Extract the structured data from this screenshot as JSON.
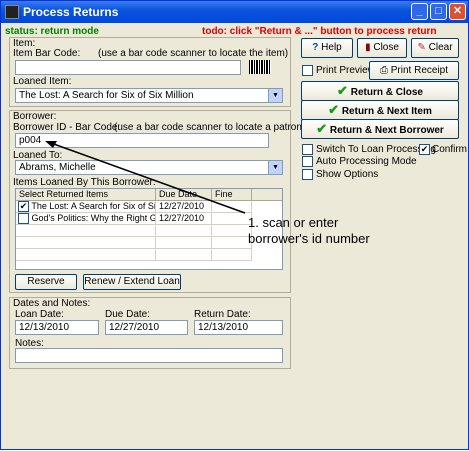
{
  "window": {
    "title": "Process Returns"
  },
  "status": {
    "mode": "status: return mode",
    "todo": "todo: click \"Return & ...\" button to process return"
  },
  "item": {
    "group_label": "Item:",
    "barcode_label": "Item Bar Code:",
    "barcode_hint": "(use a bar code scanner to locate the item)",
    "barcode_value": "",
    "loaned_label": "Loaned Item:",
    "loaned_value": "The Lost: A Search for Six of Six Million"
  },
  "borrower": {
    "group_label": "Borrower:",
    "id_label": "Borrower ID - Bar Code:",
    "id_hint": "(use a bar code scanner to locate a patron)",
    "id_value": "p004",
    "loaned_to_label": "Loaned To:",
    "loaned_to_value": "Abrams, Michelle",
    "items_label": "Items Loaned By This Borrower:",
    "columns": [
      "Select Returned Items",
      "Due Date",
      "Fine"
    ],
    "rows": [
      {
        "checked": true,
        "title": "The Lost: A Search for Six of Six Mil...",
        "due": "12/27/2010",
        "fine": ""
      },
      {
        "checked": false,
        "title": "God's Politics: Why the Right Gets I...",
        "due": "12/27/2010",
        "fine": ""
      }
    ],
    "reserve_label": "Reserve",
    "renew_label": "Renew / Extend Loan"
  },
  "dates": {
    "group_label": "Dates and Notes:",
    "loan_label": "Loan Date:",
    "loan_value": "12/13/2010",
    "due_label": "Due Date:",
    "due_value": "12/27/2010",
    "return_label": "Return Date:",
    "return_value": "12/13/2010",
    "notes_label": "Notes:",
    "notes_value": ""
  },
  "toolbar": {
    "help": "Help",
    "close": "Close",
    "clear": "Clear",
    "print_preview": "Print Preview",
    "print_receipt": "Print Receipt"
  },
  "actions": {
    "return_close": "Return & Close",
    "return_next_item": "Return & Next Item",
    "return_next_borrower": "Return & Next Borrower"
  },
  "options": {
    "switch_loan": "Switch To Loan Processing",
    "confirm": "Confirm",
    "auto_mode": "Auto Processing Mode",
    "show_options": "Show Options",
    "confirm_checked": true
  },
  "annotation": {
    "line1": "1. scan or enter",
    "line2": "borrower's id number"
  },
  "colors": {
    "check_green": "#1a9a1a",
    "status_green": "#008000",
    "todo_red": "#e00000"
  }
}
